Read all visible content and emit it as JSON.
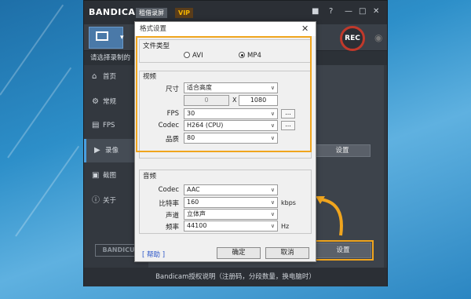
{
  "window": {
    "logo": "BANDICAM",
    "tag_record": "租借录屏",
    "tag_vip": "VIP",
    "rec_label": "REC",
    "breadcrumb": "请选择录制的",
    "footer": "Bandicam授权说明（注册码，分段数量，换电脑时）",
    "bandicut": "BANDICU",
    "settings_label_1": "设置",
    "settings_label_2": "设置"
  },
  "sidebar": {
    "items": [
      {
        "label": "首页",
        "icon": "home-icon"
      },
      {
        "label": "常规",
        "icon": "gear-icon"
      },
      {
        "label": "FPS",
        "icon": "fps-icon"
      },
      {
        "label": "录像",
        "icon": "video-icon"
      },
      {
        "label": "截图",
        "icon": "image-icon"
      },
      {
        "label": "关于",
        "icon": "info-icon"
      }
    ],
    "active": "录像"
  },
  "dialog": {
    "title": "格式设置",
    "file_type": {
      "heading": "文件类型",
      "options": [
        "AVI",
        "MP4"
      ],
      "selected": "MP4"
    },
    "video": {
      "heading": "视频",
      "size_label": "尺寸",
      "size_value": "适合高度",
      "width_value": "0",
      "x_label": "X",
      "height_value": "1080",
      "fps_label": "FPS",
      "fps_value": "30",
      "codec_label": "Codec",
      "codec_value": "H264 (CPU)",
      "quality_label": "品质",
      "quality_value": "80",
      "more_button": "..."
    },
    "audio": {
      "heading": "音频",
      "codec_label": "Codec",
      "codec_value": "AAC",
      "bitrate_label": "比特率",
      "bitrate_value": "160",
      "bitrate_unit": "kbps",
      "channel_label": "声道",
      "channel_value": "立体声",
      "freq_label": "频率",
      "freq_value": "44100",
      "freq_unit": "Hz"
    },
    "help": "[ 帮助 ]",
    "ok": "确定",
    "cancel": "取消"
  },
  "colors": {
    "highlight": "#f0a51e",
    "rec_ring": "#c0392b"
  }
}
